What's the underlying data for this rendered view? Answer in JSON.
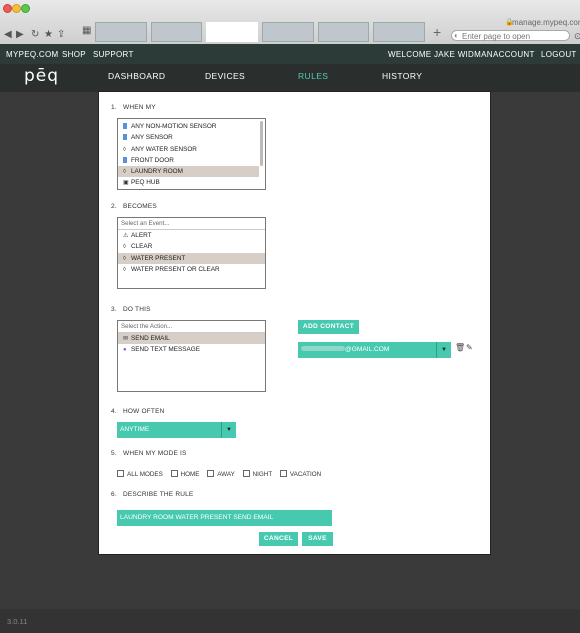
{
  "browser": {
    "url_hint": "manage.mypeq.com",
    "url_placeholder": "Enter page to open"
  },
  "topbar": {
    "left_links": [
      "MYPEQ.COM",
      "SHOP",
      "SUPPORT"
    ],
    "welcome": "WELCOME JAKE WIDMAN",
    "account": "ACCOUNT",
    "logout": "LOGOUT"
  },
  "nav": {
    "logo": "pēq",
    "items": [
      "DASHBOARD",
      "DEVICES",
      "RULES",
      "HISTORY"
    ],
    "active": "RULES"
  },
  "form": {
    "when_my": {
      "num": "1.",
      "label": "WHEN MY",
      "options": [
        {
          "label": "ANY NON-MOTION SENSOR",
          "icon": "blue-square-icon"
        },
        {
          "label": "ANY SENSOR",
          "icon": "blue-square-icon"
        },
        {
          "label": "ANY WATER SENSOR",
          "icon": "water-drop-icon"
        },
        {
          "label": "FRONT DOOR",
          "icon": "blue-square-icon"
        },
        {
          "label": "LAUNDRY ROOM",
          "icon": "water-drop-icon",
          "selected": true
        },
        {
          "label": "PEQ HUB",
          "icon": "hub-icon"
        }
      ]
    },
    "becomes": {
      "num": "2.",
      "label": "BECOMES",
      "header": "Select an Event...",
      "options": [
        {
          "label": "ALERT",
          "icon": "warning-icon"
        },
        {
          "label": "CLEAR",
          "icon": "water-drop-icon"
        },
        {
          "label": "WATER PRESENT",
          "icon": "water-drop-icon",
          "selected": true
        },
        {
          "label": "WATER PRESENT OR CLEAR",
          "icon": "water-drop-icon"
        }
      ]
    },
    "do_this": {
      "num": "3.",
      "label": "DO THIS",
      "header": "Select the Action...",
      "options": [
        {
          "label": "SEND EMAIL",
          "icon": "email-icon",
          "selected": true
        },
        {
          "label": "SEND TEXT MESSAGE",
          "icon": "chat-icon"
        }
      ],
      "add_contact": "ADD CONTACT",
      "contact_value": "@GMAIL.COM"
    },
    "how_often": {
      "num": "4.",
      "label": "HOW OFTEN",
      "value": "ANYTIME"
    },
    "mode": {
      "num": "5.",
      "label": "WHEN MY MODE IS",
      "modes": [
        "ALL MODES",
        "HOME",
        "AWAY",
        "NIGHT",
        "VACATION"
      ]
    },
    "describe": {
      "num": "6.",
      "label": "DESCRIBE THE RULE",
      "value": "LAUNDRY ROOM WATER PRESENT SEND EMAIL"
    },
    "cancel": "CANCEL",
    "save": "SAVE"
  },
  "footer": {
    "version": "3.0.11"
  },
  "colors": {
    "teal": "#47c9af",
    "selected_row": "#d7cfc7",
    "header_bg": "#2c3b37"
  }
}
